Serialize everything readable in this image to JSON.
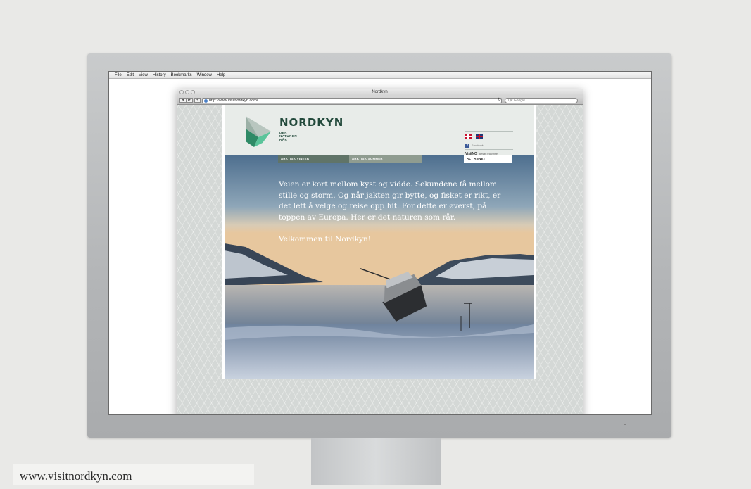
{
  "desktop_menu": [
    "File",
    "Edit",
    "View",
    "History",
    "Bookmarks",
    "Window",
    "Help"
  ],
  "browser": {
    "window_title": "Nordkyn",
    "url": "http://www.visitnordkyn.com/",
    "search_placeholder": "Google",
    "search_icon_label": "Q▾",
    "reload_glyph": "↻",
    "back_glyph": "◀",
    "forward_glyph": "▶",
    "add_glyph": "+"
  },
  "site": {
    "brand": "NORDKYN",
    "tagline": [
      "DER",
      "NATUREN",
      "RÅR"
    ],
    "facebook_label": "Facebook",
    "facebook_glyph": "f",
    "visitnorway_logo": "VisitNO",
    "visitnorway_text": "Besøk fra ymse",
    "menu": [
      "ARKTISK VINTER",
      "ARKTISK SOMMER",
      "ALT ANNET"
    ],
    "hero_paragraph": "Veien er kort mellom kyst og vidde. Sekundene få mellom stille og storm. Og når jakten gir bytte, og fisket er rikt, er det lett å velge og reise opp hit. For dette er øverst, på toppen av Europa. Her er det naturen som rår.",
    "hero_welcome": "Velkommen til Nordkyn!"
  },
  "caption": "www.visitnordkyn.com",
  "colors": {
    "brand_green": "#234a3c",
    "menu_dark": "#607468",
    "menu_light": "#8f9c90"
  }
}
